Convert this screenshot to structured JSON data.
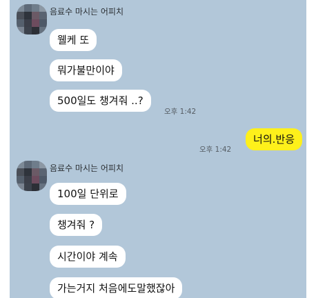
{
  "colors": {
    "chat_background": "#b2c7d9",
    "incoming_bubble": "#ffffff",
    "outgoing_bubble": "#fef01b"
  },
  "messages": {
    "group1": {
      "sender": "음료수 마시는 어피치",
      "bubbles": [
        "웰케 또",
        "뭐가불만이야",
        "500일도 챙겨줘 ..?"
      ],
      "time": "오후 1:42"
    },
    "mine": {
      "text": "너의.반응",
      "time": "오후 1:42"
    },
    "group2": {
      "sender": "음료수 마시는 어피치",
      "bubbles": [
        "100일 단위로",
        "챙겨줘 ?",
        "시간이야 계속",
        "가는거지 처음에도말했잖아"
      ]
    }
  }
}
